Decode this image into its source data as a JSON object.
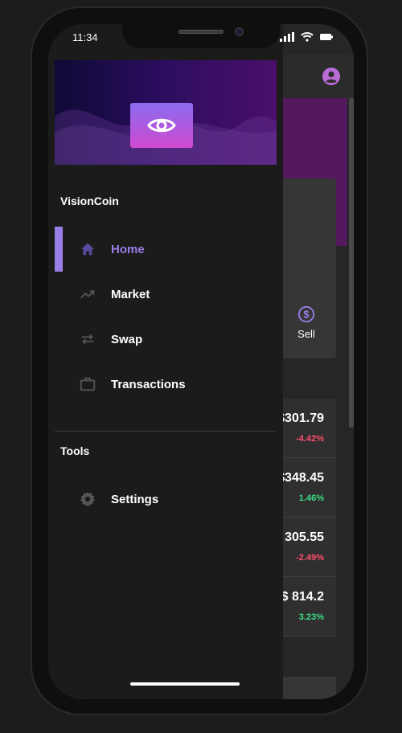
{
  "status": {
    "time": "11:34"
  },
  "app": {
    "actions": {
      "sell_label": "Sell"
    },
    "coins": [
      {
        "price": "$301.79",
        "change": "-4.42%",
        "trend": "down"
      },
      {
        "price": "$348.45",
        "change": "1.46%",
        "trend": "up"
      },
      {
        "price": "305.55",
        "change": "-2.49%",
        "trend": "down"
      },
      {
        "price": "$ 814.2",
        "change": "3.23%",
        "trend": "up"
      }
    ]
  },
  "drawer": {
    "app_name": "VisionCoin",
    "nav": [
      {
        "label": "Home",
        "icon": "home-icon",
        "active": true
      },
      {
        "label": "Market",
        "icon": "trending-up-icon",
        "active": false
      },
      {
        "label": "Swap",
        "icon": "swap-icon",
        "active": false
      },
      {
        "label": "Transactions",
        "icon": "briefcase-icon",
        "active": false
      }
    ],
    "tools_title": "Tools",
    "tools": [
      {
        "label": "Settings",
        "icon": "gear-icon"
      }
    ]
  },
  "colors": {
    "accent": "#9a7ee8",
    "negative": "#ff4d6d",
    "positive": "#3ddc84",
    "hero": "#54185e"
  }
}
